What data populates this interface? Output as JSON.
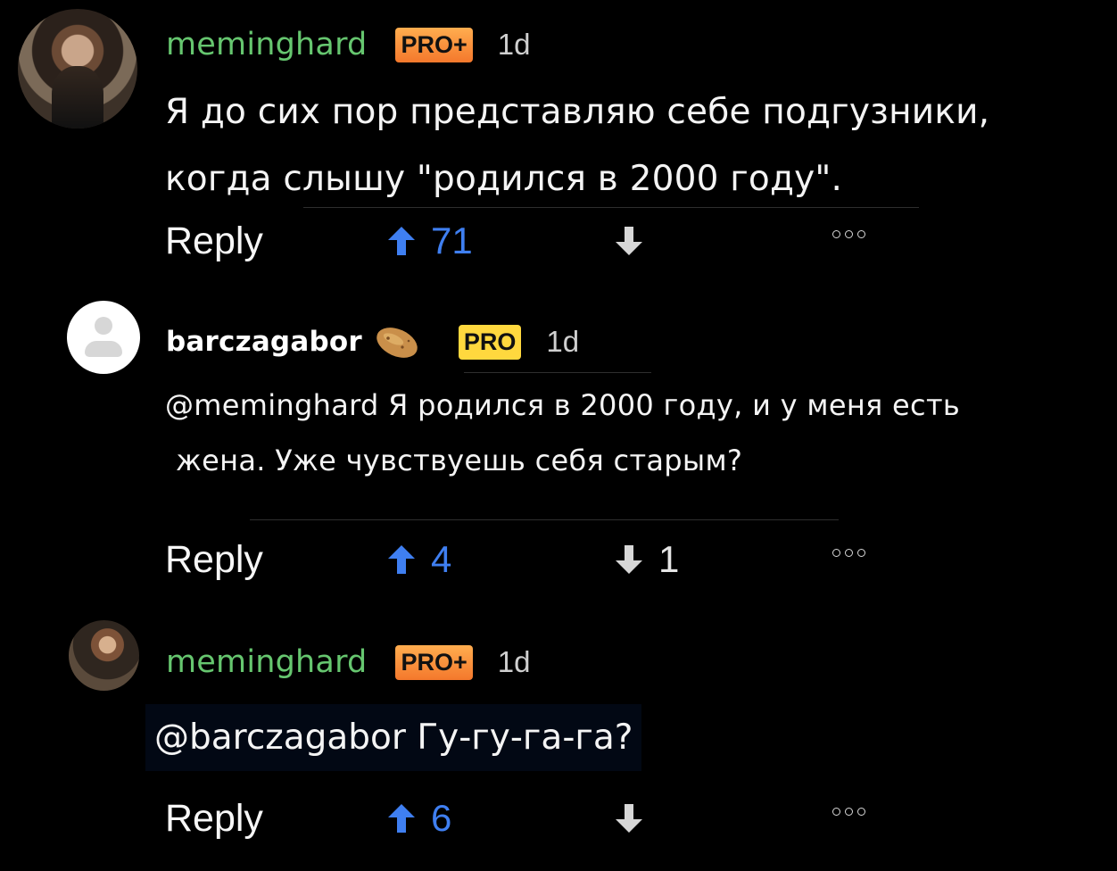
{
  "comments": [
    {
      "user": "meminghard",
      "badge": "PRO+",
      "time": "1d",
      "text_lines": [
        "Я до сих пор представляю себе подгузники,",
        "когда слышу \"родился в 2000 году\"."
      ],
      "reply": "Reply",
      "upvotes": "71",
      "downvotes": ""
    },
    {
      "user": "barczagabor",
      "badge": "PRO",
      "time": "1d",
      "text_lines": [
        "@meminghard Я родился в 2000 году, и у меня есть",
        "жена. Уже чувствуешь себя старым?"
      ],
      "reply": "Reply",
      "upvotes": "4",
      "downvotes": "1"
    },
    {
      "user": "meminghard",
      "badge": "PRO+",
      "time": "1d",
      "text_lines": [
        "@barczagabor Гу-гу-га-га?"
      ],
      "reply": "Reply",
      "upvotes": "6",
      "downvotes": ""
    }
  ],
  "colors": {
    "background": "#000000",
    "username_green": "#66c66f",
    "upvote_blue": "#3f7ff1",
    "pro_plus_badge": "#f4782c",
    "pro_badge": "#ffd83e",
    "text": "#f4f4f4"
  },
  "icons": {
    "upvote": "upvote-arrow-icon",
    "downvote": "downvote-arrow-icon",
    "more": "more-options-icon",
    "potato": "potato-emoji-icon"
  }
}
